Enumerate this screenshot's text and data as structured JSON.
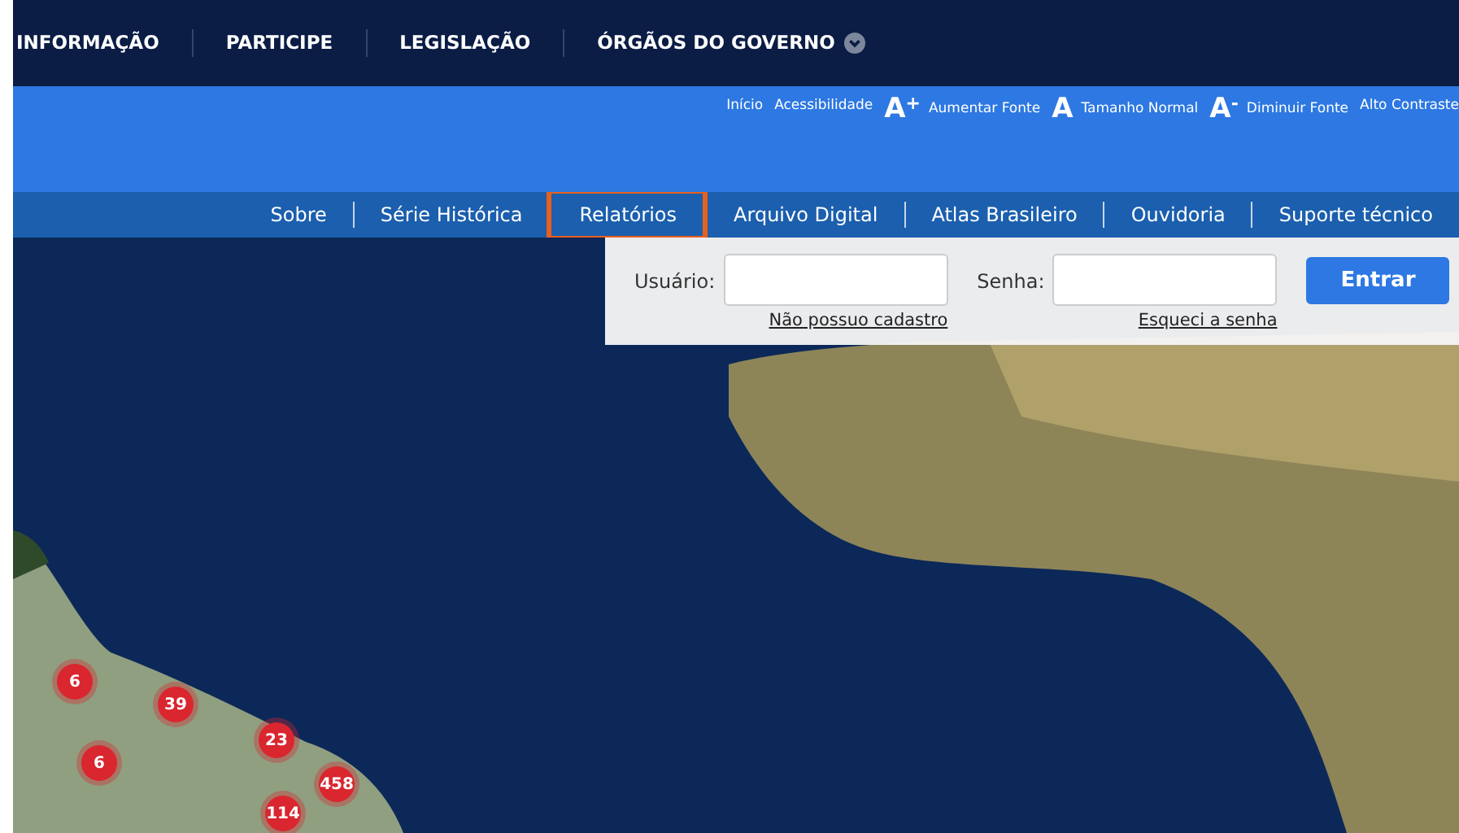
{
  "top_menu": [
    {
      "label": "INFORMAÇÃO",
      "dropdown": false
    },
    {
      "label": "PARTICIPE",
      "dropdown": false
    },
    {
      "label": "LEGISLAÇÃO",
      "dropdown": false
    },
    {
      "label": "ÓRGÃOS DO GOVERNO",
      "dropdown": true
    }
  ],
  "accessibility_bar": [
    {
      "kind": "link",
      "label": "Início"
    },
    {
      "kind": "link",
      "label": "Acessibilidade"
    },
    {
      "kind": "font",
      "glyph": "A",
      "sup": "+",
      "label": "Aumentar Fonte"
    },
    {
      "kind": "font",
      "glyph": "A",
      "label": "Tamanho Normal"
    },
    {
      "kind": "font",
      "glyph": "A",
      "sup": "-",
      "label": "Diminuir Fonte"
    },
    {
      "kind": "link",
      "label": "Alto Contraste"
    }
  ],
  "main_nav": [
    {
      "label": "Sobre",
      "selected": false
    },
    {
      "label": "Série Histórica",
      "selected": false
    },
    {
      "label": "Relatórios",
      "selected": true
    },
    {
      "label": "Arquivo Digital",
      "selected": false
    },
    {
      "label": "Atlas Brasileiro",
      "selected": false
    },
    {
      "label": "Ouvidoria",
      "selected": false
    },
    {
      "label": "Suporte técnico",
      "selected": false
    }
  ],
  "login": {
    "user_label": "Usuário:",
    "user_link": "Não possuo cadastro",
    "password_label": "Senha:",
    "password_link": "Esqueci a senha",
    "submit": "Entrar"
  },
  "map_markers": [
    {
      "count": "6"
    },
    {
      "count": "39"
    },
    {
      "count": "6"
    },
    {
      "count": "23"
    },
    {
      "count": "458"
    },
    {
      "count": "114"
    }
  ]
}
